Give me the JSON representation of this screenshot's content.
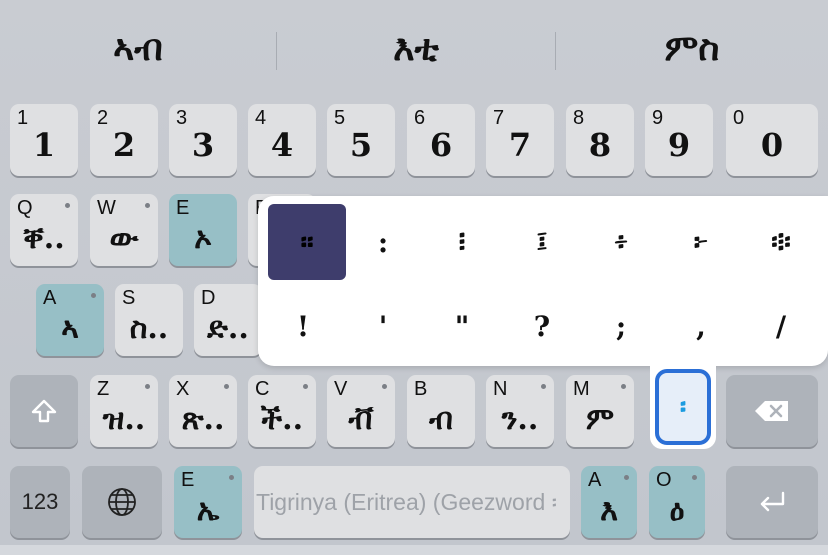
{
  "suggestions": [
    "ኣብ",
    "እቲ",
    "ምስ"
  ],
  "number_row": [
    {
      "hint": "1",
      "label": "1"
    },
    {
      "hint": "2",
      "label": "2"
    },
    {
      "hint": "3",
      "label": "3"
    },
    {
      "hint": "4",
      "label": "4"
    },
    {
      "hint": "5",
      "label": "5"
    },
    {
      "hint": "6",
      "label": "6"
    },
    {
      "hint": "7",
      "label": "7"
    },
    {
      "hint": "8",
      "label": "8"
    },
    {
      "hint": "9",
      "label": "9"
    },
    {
      "hint": "0",
      "label": "0"
    }
  ],
  "row_q": [
    {
      "hint": "Q",
      "label": "ቐ.."
    },
    {
      "hint": "W",
      "label": "ው"
    },
    {
      "hint": "E",
      "label": "ኦ"
    },
    {
      "hint": "R",
      "label": ""
    }
  ],
  "row_a": [
    {
      "hint": "A",
      "label": "ኣ"
    },
    {
      "hint": "S",
      "label": "ስ.."
    },
    {
      "hint": "D",
      "label": "ድ.."
    }
  ],
  "row_z": [
    {
      "hint": "Z",
      "label": "ዝ.."
    },
    {
      "hint": "X",
      "label": "ጽ.."
    },
    {
      "hint": "C",
      "label": "ች.."
    },
    {
      "hint": "V",
      "label": "ቭ"
    },
    {
      "hint": "B",
      "label": "ብ"
    },
    {
      "hint": "N",
      "label": "ን.."
    },
    {
      "hint": "M",
      "label": "ም"
    }
  ],
  "popup": {
    "row1": [
      "።",
      ":",
      "፧",
      "፤",
      "፥",
      "፦",
      "፨"
    ],
    "row2": [
      "!",
      "'",
      "\"",
      "?",
      ";",
      ",",
      "/"
    ]
  },
  "active_key_label": "፡",
  "bottom": {
    "numbers_label": "123",
    "e_key": {
      "hint": "E",
      "label": "ኤ"
    },
    "space_placeholder": "Tigrinya (Eritrea) (Geezword ፡",
    "a_key": {
      "hint": "A",
      "label": "እ"
    },
    "o_key": {
      "hint": "O",
      "label": "ዕ"
    }
  },
  "colors": {
    "accent": "#2b6fd6",
    "blue_key": "#97bfc6",
    "selected": "#3e3d6c"
  }
}
